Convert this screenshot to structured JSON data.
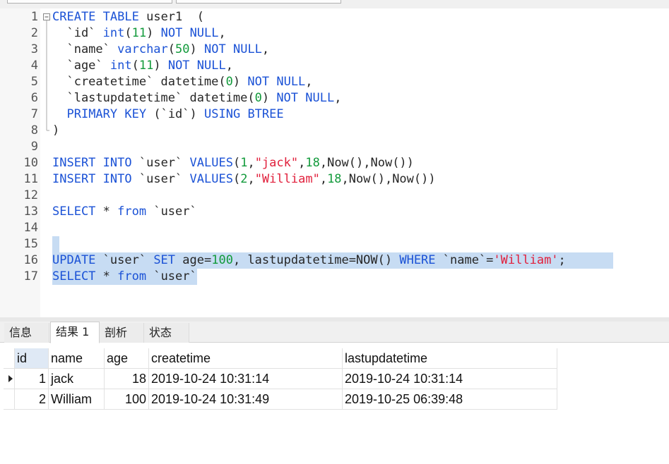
{
  "editor": {
    "lines": [
      {
        "n": "1",
        "fold": "box",
        "tokens": [
          [
            "kw",
            "CREATE"
          ],
          [
            "tx",
            " "
          ],
          [
            "kw",
            "TABLE"
          ],
          [
            "tx",
            " user1  ("
          ]
        ]
      },
      {
        "n": "2",
        "fold": "bar",
        "tokens": [
          [
            "tx",
            "  `id` "
          ],
          [
            "kw",
            "int"
          ],
          [
            "tx",
            "("
          ],
          [
            "num",
            "11"
          ],
          [
            "tx",
            ") "
          ],
          [
            "kw",
            "NOT"
          ],
          [
            "tx",
            " "
          ],
          [
            "kw",
            "NULL"
          ],
          [
            "tx",
            ","
          ]
        ]
      },
      {
        "n": "3",
        "fold": "bar",
        "tokens": [
          [
            "tx",
            "  `name` "
          ],
          [
            "kw",
            "varchar"
          ],
          [
            "tx",
            "("
          ],
          [
            "num",
            "50"
          ],
          [
            "tx",
            ") "
          ],
          [
            "kw",
            "NOT"
          ],
          [
            "tx",
            " "
          ],
          [
            "kw",
            "NULL"
          ],
          [
            "tx",
            ","
          ]
        ]
      },
      {
        "n": "4",
        "fold": "bar",
        "tokens": [
          [
            "tx",
            "  `age` "
          ],
          [
            "kw",
            "int"
          ],
          [
            "tx",
            "("
          ],
          [
            "num",
            "11"
          ],
          [
            "tx",
            ") "
          ],
          [
            "kw",
            "NOT"
          ],
          [
            "tx",
            " "
          ],
          [
            "kw",
            "NULL"
          ],
          [
            "tx",
            ","
          ]
        ]
      },
      {
        "n": "5",
        "fold": "bar",
        "tokens": [
          [
            "tx",
            "  `createtime` datetime("
          ],
          [
            "num",
            "0"
          ],
          [
            "tx",
            ") "
          ],
          [
            "kw",
            "NOT"
          ],
          [
            "tx",
            " "
          ],
          [
            "kw",
            "NULL"
          ],
          [
            "tx",
            ","
          ]
        ]
      },
      {
        "n": "6",
        "fold": "bar",
        "tokens": [
          [
            "tx",
            "  `lastupdatetime` datetime("
          ],
          [
            "num",
            "0"
          ],
          [
            "tx",
            ") "
          ],
          [
            "kw",
            "NOT"
          ],
          [
            "tx",
            " "
          ],
          [
            "kw",
            "NULL"
          ],
          [
            "tx",
            ","
          ]
        ]
      },
      {
        "n": "7",
        "fold": "bar",
        "tokens": [
          [
            "tx",
            "  "
          ],
          [
            "kw",
            "PRIMARY"
          ],
          [
            "tx",
            " "
          ],
          [
            "kw",
            "KEY"
          ],
          [
            "tx",
            " (`id`) "
          ],
          [
            "kw",
            "USING"
          ],
          [
            "tx",
            " "
          ],
          [
            "kw",
            "BTREE"
          ]
        ]
      },
      {
        "n": "8",
        "fold": "end",
        "tokens": [
          [
            "tx",
            ")"
          ]
        ]
      },
      {
        "n": "9",
        "fold": "",
        "tokens": []
      },
      {
        "n": "10",
        "fold": "",
        "tokens": [
          [
            "kw",
            "INSERT"
          ],
          [
            "tx",
            " "
          ],
          [
            "kw",
            "INTO"
          ],
          [
            "tx",
            " `user` "
          ],
          [
            "kw",
            "VALUES"
          ],
          [
            "tx",
            "("
          ],
          [
            "num",
            "1"
          ],
          [
            "tx",
            ","
          ],
          [
            "str",
            "\"jack\""
          ],
          [
            "tx",
            ","
          ],
          [
            "num",
            "18"
          ],
          [
            "tx",
            ",Now(),Now())"
          ]
        ]
      },
      {
        "n": "11",
        "fold": "",
        "tokens": [
          [
            "kw",
            "INSERT"
          ],
          [
            "tx",
            " "
          ],
          [
            "kw",
            "INTO"
          ],
          [
            "tx",
            " `user` "
          ],
          [
            "kw",
            "VALUES"
          ],
          [
            "tx",
            "("
          ],
          [
            "num",
            "2"
          ],
          [
            "tx",
            ","
          ],
          [
            "str",
            "\"William\""
          ],
          [
            "tx",
            ","
          ],
          [
            "num",
            "18"
          ],
          [
            "tx",
            ",Now(),Now())"
          ]
        ]
      },
      {
        "n": "12",
        "fold": "",
        "tokens": []
      },
      {
        "n": "13",
        "fold": "",
        "tokens": [
          [
            "kw",
            "SELECT"
          ],
          [
            "tx",
            " * "
          ],
          [
            "kw",
            "from"
          ],
          [
            "tx",
            " `user`"
          ]
        ]
      },
      {
        "n": "14",
        "fold": "",
        "tokens": []
      },
      {
        "n": "15",
        "fold": "",
        "hl": "partial",
        "tokens": []
      },
      {
        "n": "16",
        "fold": "",
        "hl": "full",
        "tokens": [
          [
            "kw",
            "UPDATE"
          ],
          [
            "tx",
            " `user` "
          ],
          [
            "kw",
            "SET"
          ],
          [
            "tx",
            " age="
          ],
          [
            "num",
            "100"
          ],
          [
            "tx",
            ", lastupdatetime=NOW() "
          ],
          [
            "kw",
            "WHERE"
          ],
          [
            "tx",
            " `name`="
          ],
          [
            "str",
            "'William'"
          ],
          [
            "tx",
            ";"
          ]
        ]
      },
      {
        "n": "17",
        "fold": "",
        "hl": "text",
        "tokens": [
          [
            "kw",
            "SELECT"
          ],
          [
            "tx",
            " * "
          ],
          [
            "kw",
            "from"
          ],
          [
            "tx",
            " `user`"
          ]
        ]
      }
    ]
  },
  "tabs": {
    "info": "信息",
    "result1": "结果 1",
    "profile": "剖析",
    "status": "状态"
  },
  "grid": {
    "columns": [
      "id",
      "name",
      "age",
      "createtime",
      "lastupdatetime"
    ],
    "rows": [
      [
        "1",
        "jack",
        "18",
        "2019-10-24 10:31:14",
        "2019-10-24 10:31:14"
      ],
      [
        "2",
        "William",
        "100",
        "2019-10-24 10:31:49",
        "2019-10-25 06:39:48"
      ]
    ]
  }
}
